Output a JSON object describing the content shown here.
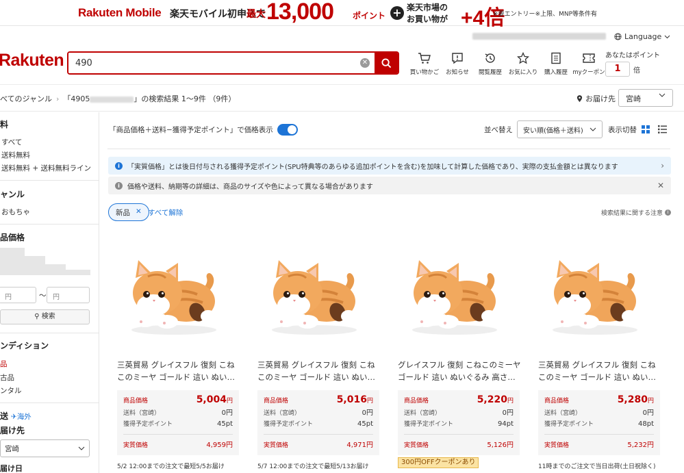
{
  "banner": {
    "brand": "Rakuten Mobile",
    "text1": "楽天モバイル初申込で",
    "text2": "最大",
    "big_number": "13,000",
    "points": "ポイント",
    "plus": "+",
    "ichiba_line1": "楽天市場の",
    "ichiba_line2": "お買い物が",
    "times": "+4倍",
    "note": "※要エントリー※上限、MNP等条件有"
  },
  "header": {
    "logo": "Rakuten",
    "search_value": "490",
    "language": "Language",
    "icons": [
      {
        "name": "cart-icon",
        "label": "買い物かご"
      },
      {
        "name": "notification-icon",
        "label": "お知らせ"
      },
      {
        "name": "history-icon",
        "label": "閲覧履歴"
      },
      {
        "name": "star-icon",
        "label": "お気に入り"
      },
      {
        "name": "receipt-icon",
        "label": "購入履歴"
      },
      {
        "name": "coupon-icon",
        "label": "myクーポン"
      }
    ],
    "points_label": "あなたはポイント",
    "points_value": "1",
    "points_unit": "倍"
  },
  "breadcrumb": {
    "root": "べてのジャンル",
    "query_prefix": "「4905",
    "result": "」の検索結果 1～9件 （9件）",
    "deliver_label": "お届け先",
    "deliver_value": "宮崎"
  },
  "sidebar": {
    "shipping_title": "料",
    "shipping_items": [
      "すべて",
      "送料無料",
      "送料無料 + 送料無料ライン"
    ],
    "genre_title": "ャンル",
    "genre_items": [
      "おもちゃ"
    ],
    "price_title": "品価格",
    "price_min_placeholder": "円",
    "price_sep": "～",
    "price_max_placeholder": "円",
    "price_search": "検索",
    "condition_title": "ンディション",
    "condition_items": [
      "品",
      "古品",
      "ンタル"
    ],
    "ship_title": "送",
    "ship_overseas": "海外",
    "deliver_title": "届け先",
    "deliver_value": "宮崎",
    "date_title": "届け日"
  },
  "main": {
    "price_display_label": "「商品価格＋送料−獲得予定ポイント」で価格表示",
    "sort_label": "並べ替え",
    "sort_value": "安い順(価格＋送料)",
    "view_label": "表示切替",
    "notice1": "「実質価格」とは後日付与される獲得予定ポイント(SPU特典等のあらゆる追加ポイントを含む)を加味して計算した価格であり、実際の支払金額とは異なります",
    "notice2": "価格や送料、納期等の詳細は、商品のサイズや色によって異なる場合があります",
    "filter_chip": "新品",
    "clear_all": "すべて解除",
    "attention": "検索結果に関する注意"
  },
  "labels": {
    "price": "商品価格",
    "shipping": "送料（宮崎）",
    "points": "獲得予定ポイント",
    "real": "実質価格"
  },
  "products": [
    {
      "name": "三英貿易 グレイスフル 復刻 こねこのミーヤ ゴールド 這い ぬい…",
      "price": "5,004",
      "shipping": "0円",
      "points": "45pt",
      "real": "4,959円",
      "note": "5/2 12:00までの注文で最短5/5お届け"
    },
    {
      "name": "三英貿易 グレイスフル 復刻 こねこのミーヤ ゴールド 這い ぬい…",
      "price": "5,016",
      "shipping": "0円",
      "points": "45pt",
      "real": "4,971円",
      "note": "5/7 12:00までの注文で最短5/13お届け"
    },
    {
      "name": "グレイスフル 復刻 こねこのミーヤ ゴールド 這い ぬいぐるみ 高さ…",
      "price": "5,220",
      "shipping": "0円",
      "points": "94pt",
      "real": "5,126円",
      "coupon": "300円OFFクーポンあり"
    },
    {
      "name": "三英貿易 グレイスフル 復刻 こねこのミーヤ ゴールド 這い ぬい…",
      "price": "5,280",
      "shipping": "0円",
      "points": "48pt",
      "real": "5,232円",
      "note": "11時までのご注文で当日出荷(土日祝除く)"
    }
  ],
  "yen": "円",
  "colors": {
    "brand": "#bf0000",
    "link": "#1d74d6"
  }
}
